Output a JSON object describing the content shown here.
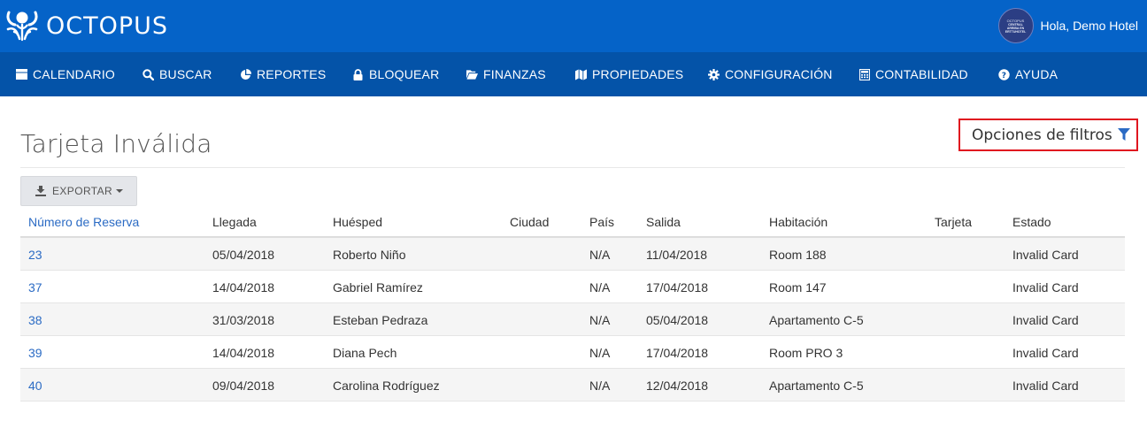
{
  "app": {
    "logo_text": "OCTOPUS",
    "greeting": "Hola, Demo Hotel",
    "avatar_lines": [
      "OCTOPUS",
      "CENTRAL",
      "ARRIBA EN",
      "ERTTUHOTEL"
    ]
  },
  "nav": {
    "items": [
      {
        "label": "CALENDARIO",
        "icon": "calendar-icon"
      },
      {
        "label": "BUSCAR",
        "icon": "search-icon"
      },
      {
        "label": "REPORTES",
        "icon": "pie-chart-icon"
      },
      {
        "label": "BLOQUEAR",
        "icon": "lock-icon"
      },
      {
        "label": "FINANZAS",
        "icon": "folder-open-icon"
      },
      {
        "label": "PROPIEDADES",
        "icon": "map-icon"
      },
      {
        "label": "CONFIGURACIÓN",
        "icon": "gear-icon"
      },
      {
        "label": "CONTABILIDAD",
        "icon": "calculator-icon"
      },
      {
        "label": "AYUDA",
        "icon": "question-icon"
      }
    ]
  },
  "page": {
    "title": "Tarjeta Inválida",
    "filter_label": "Opciones de filtros",
    "export_label": "EXPORTAR"
  },
  "colors": {
    "topbar": "#0563c8",
    "navbar": "#0453a8",
    "link": "#2b6bc4",
    "filter_border": "#e0161f"
  },
  "table": {
    "headers": [
      "Número de Reserva",
      "Llegada",
      "Huésped",
      "Ciudad",
      "País",
      "Salida",
      "Habitación",
      "Tarjeta",
      "Estado"
    ],
    "rows": [
      [
        "23",
        "05/04/2018",
        "Roberto Niño",
        "",
        "N/A",
        "11/04/2018",
        "Room 188",
        "",
        "Invalid Card"
      ],
      [
        "37",
        "14/04/2018",
        "Gabriel Ramírez",
        "",
        "N/A",
        "17/04/2018",
        "Room 147",
        "",
        "Invalid Card"
      ],
      [
        "38",
        "31/03/2018",
        "Esteban Pedraza",
        "",
        "N/A",
        "05/04/2018",
        "Apartamento C-5",
        "",
        "Invalid Card"
      ],
      [
        "39",
        "14/04/2018",
        "Diana Pech",
        "",
        "N/A",
        "17/04/2018",
        "Room PRO 3",
        "",
        "Invalid Card"
      ],
      [
        "40",
        "09/04/2018",
        "Carolina Rodríguez",
        "",
        "N/A",
        "12/04/2018",
        "Apartamento C-5",
        "",
        "Invalid Card"
      ]
    ]
  }
}
